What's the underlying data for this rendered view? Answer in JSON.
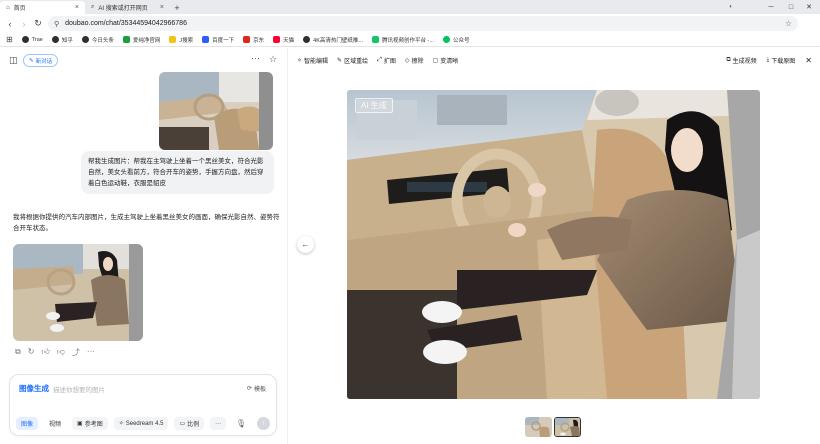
{
  "browser": {
    "tabs": [
      {
        "title": "首页"
      },
      {
        "title": "AI 搜索或打开网页"
      }
    ],
    "new_tab": "+",
    "window_controls": [
      "─",
      "□",
      "✕"
    ],
    "url": "doubao.com/chat/35344594042966786",
    "bookmarks": [
      {
        "label": "Trae",
        "color": "#2f2f2f"
      },
      {
        "label": "知乎",
        "color": "#2f2f2f"
      },
      {
        "label": "今日头条",
        "color": "#2f2f2f"
      },
      {
        "label": "爱纯净官网",
        "color": "#1a9e3e"
      },
      {
        "label": "J搜索",
        "color": "#f0c419"
      },
      {
        "label": "百度一下",
        "color": "#2e5cff"
      },
      {
        "label": "京东",
        "color": "#e1251b"
      },
      {
        "label": "天猫",
        "color": "#ff0036"
      },
      {
        "label": "4K高清热门壁纸推...",
        "color": "#2f2f2f"
      },
      {
        "label": "腾讯视频创作平台 -...",
        "color": "#17c663"
      },
      {
        "label": "公众号",
        "color": "#07c160"
      }
    ]
  },
  "chat": {
    "new_chat_label": "新对话",
    "user_message": "帮我生成图片：帮我在主驾驶上坐着一个黑丝美女，符合光影自然，美女头看前方，符合开车的姿势，手握方向盘，然后穿着白色运动鞋，衣服是貂皮",
    "assistant_reply": "我将根据你提供的汽车内部图片，生成主驾驶上坐着黑丝美女的画面，确保光影自然、姿势符合开车状态。",
    "composer": {
      "mode_label": "图像生成",
      "placeholder": "描述你想要的图片",
      "template_label": "模板",
      "tools": [
        {
          "label": "图像",
          "selected": true
        },
        {
          "label": "视频",
          "selected": false
        },
        {
          "label": "参考图",
          "selected": false
        },
        {
          "label": "Seedream 4.5",
          "selected": false
        },
        {
          "label": "比例",
          "selected": false
        }
      ]
    }
  },
  "preview": {
    "tools_left": [
      "智能编辑",
      "区域重绘",
      "扩图",
      "擦除",
      "变清晰"
    ],
    "tools_right": [
      "生成视频",
      "下载原图"
    ],
    "ai_tag": "AI 生成"
  },
  "colors": {
    "accent": "#1f6fff",
    "interior_beige": "#cdb89a",
    "fur": "#8a7560"
  }
}
